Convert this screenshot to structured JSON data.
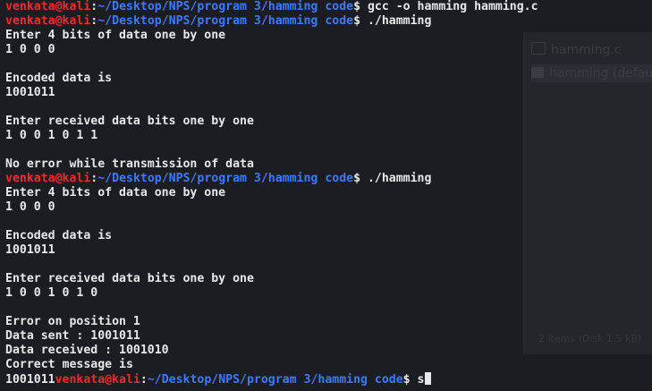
{
  "background_window": {
    "items": [
      "hamming.c",
      "hamming (default)"
    ],
    "status": "2 items (Disk 1.5 kB)"
  },
  "prompt": {
    "user": "venkata",
    "at": "@",
    "host": "kali",
    "colon": ":",
    "path": "~/Desktop/NPS/program 3/hamming code",
    "dollar": "$"
  },
  "terminal": {
    "lines": [
      {
        "type": "prompt",
        "cmd": " gcc -o hamming hamming.c"
      },
      {
        "type": "prompt",
        "cmd": " ./hamming"
      },
      {
        "type": "text",
        "text": "Enter 4 bits of data one by one"
      },
      {
        "type": "text",
        "text": "1 0 0 0"
      },
      {
        "type": "text",
        "text": ""
      },
      {
        "type": "text",
        "text": "Encoded data is"
      },
      {
        "type": "text",
        "text": "1001011"
      },
      {
        "type": "text",
        "text": ""
      },
      {
        "type": "text",
        "text": "Enter received data bits one by one"
      },
      {
        "type": "text",
        "text": "1 0 0 1 0 1 1"
      },
      {
        "type": "text",
        "text": ""
      },
      {
        "type": "text",
        "text": "No error while transmission of data"
      },
      {
        "type": "prompt",
        "cmd": " ./hamming"
      },
      {
        "type": "text",
        "text": "Enter 4 bits of data one by one"
      },
      {
        "type": "text",
        "text": "1 0 0 0"
      },
      {
        "type": "text",
        "text": ""
      },
      {
        "type": "text",
        "text": "Encoded data is"
      },
      {
        "type": "text",
        "text": "1001011"
      },
      {
        "type": "text",
        "text": ""
      },
      {
        "type": "text",
        "text": "Enter received data bits one by one"
      },
      {
        "type": "text",
        "text": "1 0 0 1 0 1 0"
      },
      {
        "type": "text",
        "text": ""
      },
      {
        "type": "text",
        "text": "Error on position 1"
      },
      {
        "type": "text",
        "text": "Data sent : 1001011"
      },
      {
        "type": "text",
        "text": "Data received : 1001010"
      },
      {
        "type": "text",
        "text": "Correct message is"
      },
      {
        "type": "prompt",
        "prefix": "1001011",
        "cmd": " s",
        "cursor": true
      }
    ]
  }
}
